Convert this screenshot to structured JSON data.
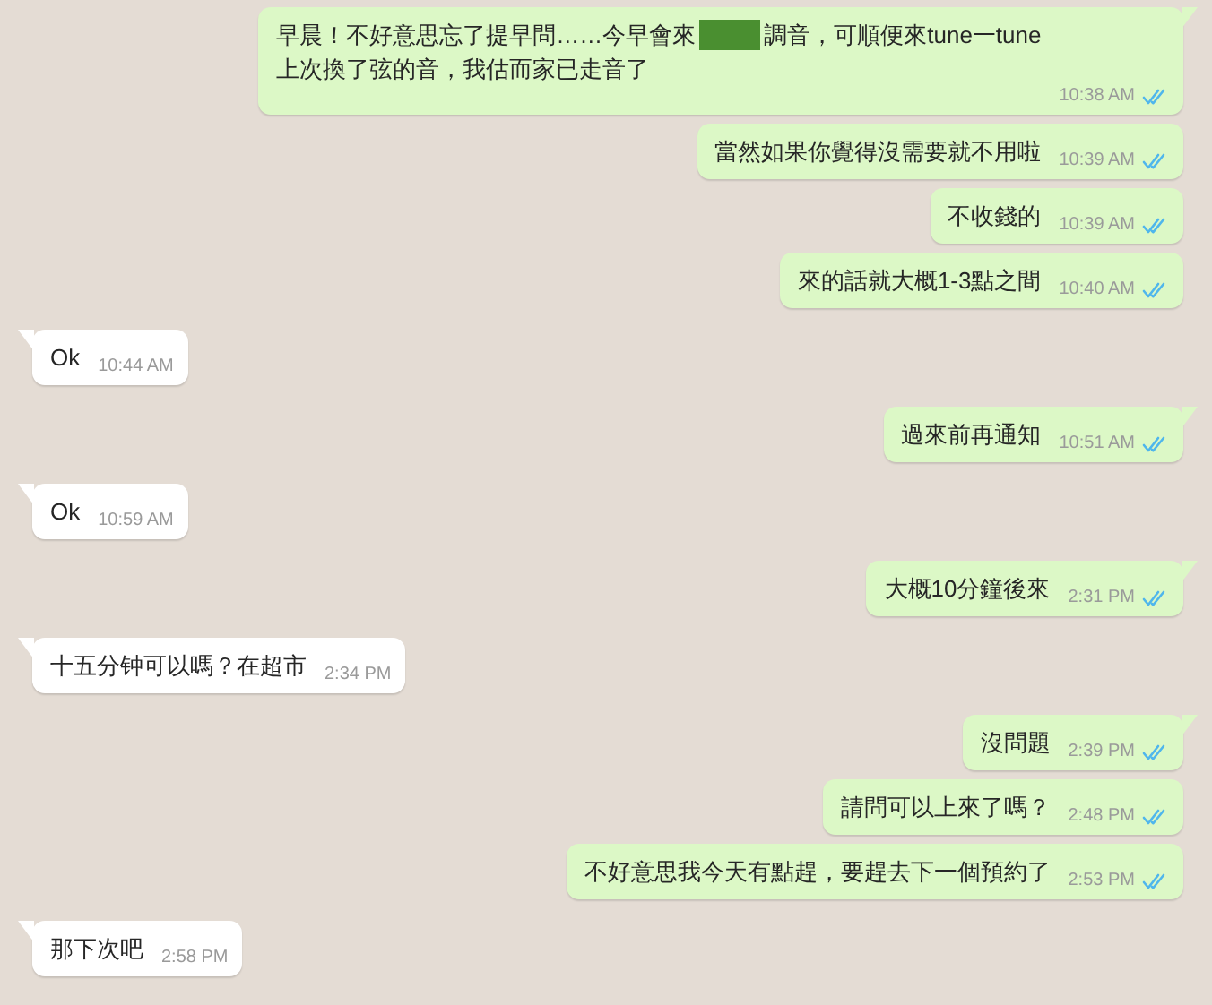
{
  "messages": [
    {
      "kind": "sent",
      "tail": true,
      "lines": [
        [
          {
            "kind": "text",
            "text": "早晨！不好意思忘了提早問……今早會來"
          },
          {
            "kind": "redaction"
          },
          {
            "kind": "text",
            "text": "調音，可順便來tune一tune"
          }
        ],
        [
          {
            "kind": "text",
            "text": "上次換了弦的音，我估而家已走音了"
          }
        ]
      ],
      "time": "10:38 AM",
      "read": true
    },
    {
      "kind": "sent",
      "tail": false,
      "segments": [
        {
          "kind": "text",
          "text": "當然如果你覺得沒需要就不用啦"
        }
      ],
      "time": "10:39 AM",
      "read": true
    },
    {
      "kind": "sent",
      "tail": false,
      "segments": [
        {
          "kind": "text",
          "text": "不收錢的"
        }
      ],
      "time": "10:39 AM",
      "read": true
    },
    {
      "kind": "sent",
      "tail": false,
      "segments": [
        {
          "kind": "text",
          "text": "來的話就大概1-3點之間"
        }
      ],
      "time": "10:40 AM",
      "read": true
    },
    {
      "kind": "received",
      "tail": true,
      "segments": [
        {
          "kind": "text",
          "text": "Ok"
        }
      ],
      "time": "10:44 AM"
    },
    {
      "kind": "sent",
      "tail": true,
      "segments": [
        {
          "kind": "text",
          "text": "過來前再通知"
        }
      ],
      "time": "10:51 AM",
      "read": true
    },
    {
      "kind": "received",
      "tail": true,
      "segments": [
        {
          "kind": "text",
          "text": "Ok"
        }
      ],
      "time": "10:59 AM"
    },
    {
      "kind": "sent",
      "tail": true,
      "segments": [
        {
          "kind": "text",
          "text": "大概10分鐘後來"
        }
      ],
      "time": "2:31 PM",
      "read": true
    },
    {
      "kind": "received",
      "tail": true,
      "segments": [
        {
          "kind": "text",
          "text": "十五分钟可以嗎？在超市"
        }
      ],
      "time": "2:34 PM"
    },
    {
      "kind": "sent",
      "tail": true,
      "segments": [
        {
          "kind": "text",
          "text": "沒問題"
        }
      ],
      "time": "2:39 PM",
      "read": true
    },
    {
      "kind": "sent",
      "tail": false,
      "segments": [
        {
          "kind": "text",
          "text": "請問可以上來了嗎？"
        }
      ],
      "time": "2:48 PM",
      "read": true
    },
    {
      "kind": "sent",
      "tail": false,
      "segments": [
        {
          "kind": "text",
          "text": "不好意思我今天有點趕，要趕去下一個預約了"
        }
      ],
      "time": "2:53 PM",
      "read": true
    },
    {
      "kind": "received",
      "tail": true,
      "segments": [
        {
          "kind": "text",
          "text": "那下次吧"
        }
      ],
      "time": "2:58 PM"
    }
  ]
}
